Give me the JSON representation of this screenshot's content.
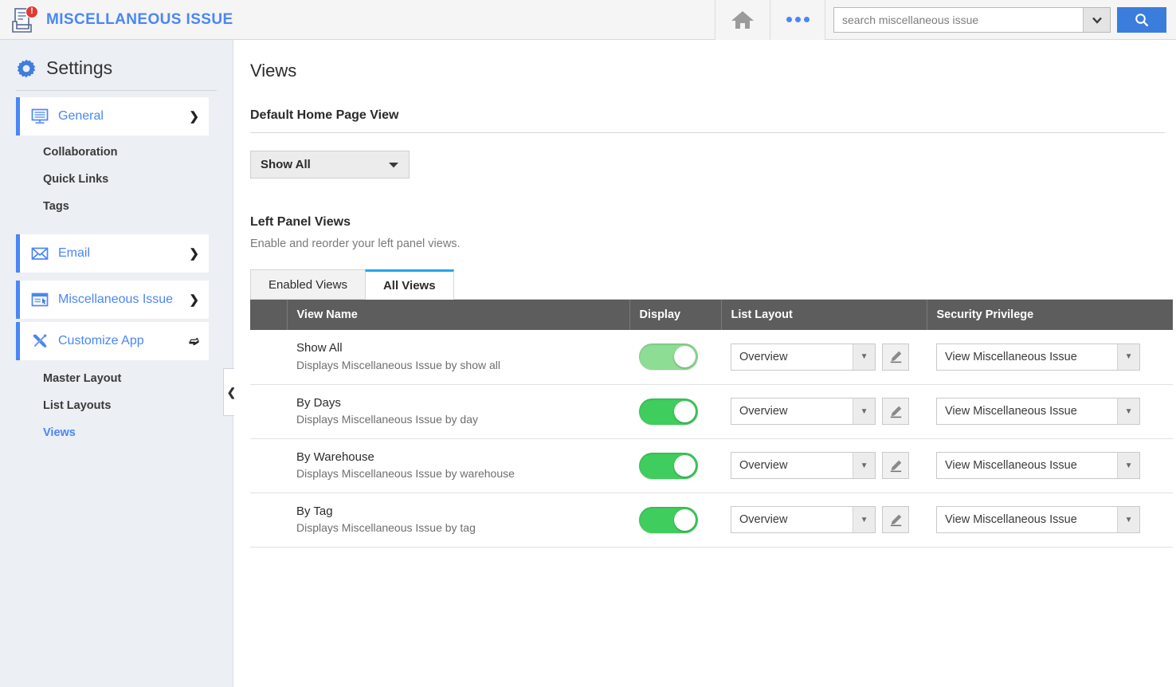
{
  "topbar": {
    "app_icon": "document-printer-icon",
    "badge": "!",
    "app_title": "MISCELLANEOUS ISSUE",
    "home_icon": "home-icon",
    "more_icon": "more-dots-icon",
    "search": {
      "value": "",
      "placeholder": "search miscellaneous issue",
      "dropdown_icon": "chevron-down-icon",
      "button_icon": "search-icon"
    }
  },
  "sidebar": {
    "heading": "Settings",
    "gear_icon": "gear-icon",
    "collapse_icon": "chevron-left-icon",
    "groups": [
      {
        "label": "General",
        "icon": "monitor-icon",
        "chevron": "chevron-right-icon",
        "children": [
          "Collaboration",
          "Quick Links",
          "Tags"
        ]
      },
      {
        "label": "Email",
        "icon": "envelope-icon",
        "chevron": "chevron-right-icon",
        "children": []
      },
      {
        "label": "Miscellaneous Issue",
        "icon": "window-cursor-icon",
        "chevron": "chevron-right-icon",
        "children": []
      },
      {
        "label": "Customize App",
        "icon": "wrench-screwdriver-icon",
        "chevron": "chevron-down-icon",
        "children": [
          "Master Layout",
          "List Layouts",
          "Views"
        ]
      }
    ],
    "active_child": "Views"
  },
  "main": {
    "page_title": "Views",
    "default_home": {
      "title": "Default Home Page View",
      "selected": "Show All",
      "caret_icon": "caret-down-icon"
    },
    "left_panel": {
      "title": "Left Panel Views",
      "subtitle": "Enable and reorder your left panel views."
    },
    "tabs": [
      {
        "label": "Enabled Views",
        "active": false
      },
      {
        "label": "All Views",
        "active": true
      }
    ],
    "table": {
      "columns": [
        "",
        "View Name",
        "Display",
        "List Layout",
        "Security Privilege"
      ],
      "rows": [
        {
          "name": "Show All",
          "desc": "Displays Miscellaneous Issue by show all",
          "display_on": true,
          "toggle_color": "#8edd94",
          "list_layout": "Overview",
          "security_privilege": "View Miscellaneous Issue",
          "edit_icon": "pencil-icon"
        },
        {
          "name": "By Days",
          "desc": "Displays Miscellaneous Issue by day",
          "display_on": true,
          "toggle_color": "#3fce5d",
          "list_layout": "Overview",
          "security_privilege": "View Miscellaneous Issue",
          "edit_icon": "pencil-icon"
        },
        {
          "name": "By Warehouse",
          "desc": "Displays Miscellaneous Issue by warehouse",
          "display_on": true,
          "toggle_color": "#3fce5d",
          "list_layout": "Overview",
          "security_privilege": "View Miscellaneous Issue",
          "edit_icon": "pencil-icon"
        },
        {
          "name": "By Tag",
          "desc": "Displays Miscellaneous Issue by tag",
          "display_on": true,
          "toggle_color": "#3fce5d",
          "list_layout": "Overview",
          "security_privilege": "View Miscellaneous Issue",
          "edit_icon": "pencil-icon"
        }
      ]
    }
  },
  "colors": {
    "brand_blue": "#4a86f7",
    "accent_blue": "#3b7ddd",
    "tab_active_blue": "#22a7e8",
    "header_gray": "#5d5d5d",
    "badge_red": "#e03b2f",
    "toggle_green": "#3fce5d",
    "toggle_green_light": "#8edd94"
  }
}
